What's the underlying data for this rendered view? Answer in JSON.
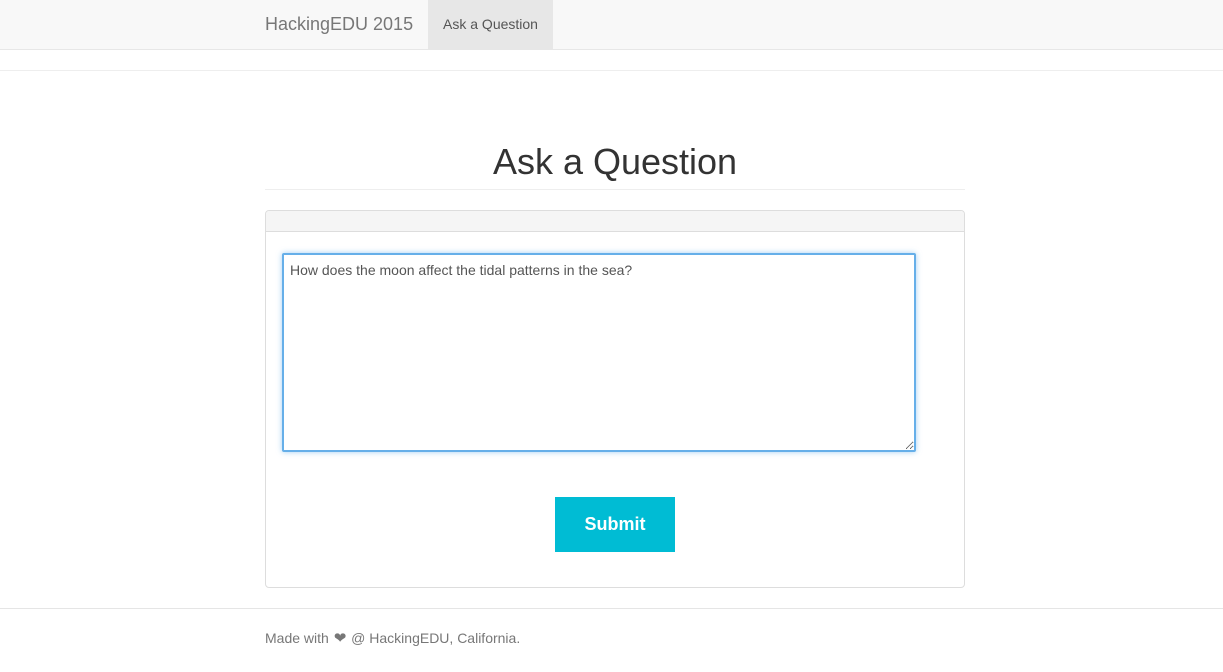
{
  "navbar": {
    "brand": "HackingEDU 2015",
    "links": [
      {
        "label": "Ask a Question",
        "active": true
      }
    ]
  },
  "page": {
    "title": "Ask a Question"
  },
  "form": {
    "question_value": "How does the moon affect the tidal patterns in the sea?",
    "submit_label": "Submit"
  },
  "footer": {
    "prefix": "Made with",
    "heart_icon": "heart-icon",
    "suffix": "@ HackingEDU, California."
  },
  "colors": {
    "accent": "#00bcd4",
    "focus_border": "#66afe9",
    "navbar_bg": "#f8f8f8",
    "active_nav_bg": "#e7e7e7"
  }
}
